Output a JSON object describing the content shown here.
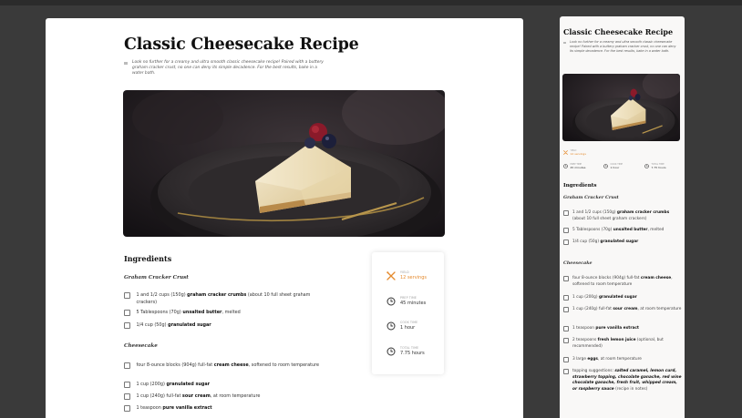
{
  "recipe": {
    "title": "Classic Cheesecake Recipe",
    "intro": "Look no further for a creamy and ultra smooth classic cheesecake recipe! Paired with a buttery graham cracker crust, no one can deny its simple decadence. For the best results, bake in a water bath.",
    "hero_alt": "slice of cheesecake with berries on a dark plate"
  },
  "ingredients": {
    "heading": "Ingredients",
    "groups": [
      {
        "name": "Graham Cracker Crust",
        "items": [
          {
            "pre": "1 and 1/2 cups (150g) ",
            "bold": "graham cracker crumbs",
            "post": " (about 10 full sheet graham crackers)"
          },
          {
            "pre": "5 Tablespoons (70g) ",
            "bold": "unsalted butter",
            "post": ", melted"
          },
          {
            "pre": "1/4 cup (50g) ",
            "bold": "granulated sugar",
            "post": ""
          }
        ]
      },
      {
        "name": "Cheesecake",
        "items": [
          {
            "pre": "four 8-ounce blocks (904g) full-fat ",
            "bold": "cream cheese",
            "post": ", softened to room temperature"
          },
          {
            "pre": "1 cup (200g) ",
            "bold": "granulated sugar",
            "post": ""
          },
          {
            "pre": "1 cup (240g) full-fat ",
            "bold": "sour cream",
            "post": ", at room temperature"
          },
          {
            "pre": "1 teaspoon ",
            "bold": "pure vanilla extract",
            "post": ""
          },
          {
            "pre": "2 teaspoons ",
            "bold": "fresh lemon juice",
            "post": " (optional, but recommended)"
          },
          {
            "pre": "3 large ",
            "bold": "eggs",
            "post": ", at room temperature"
          },
          {
            "pre": "topping suggestions: ",
            "italic": "salted caramel, lemon curd, strawberry topping, chocolate ganache, red wine chocolate ganache, fresh fruit, whipped cream, or raspberry sauce",
            "post": " (recipe in notes)"
          }
        ]
      }
    ]
  },
  "meta": {
    "yield": {
      "label": "Yield",
      "value": "12 servings"
    },
    "prep": {
      "label": "Prep Time",
      "value": "45 minutes"
    },
    "cook": {
      "label": "Cook Time",
      "value": "1 hour"
    },
    "total": {
      "label": "Total Time",
      "value": "7.75 hours"
    }
  },
  "colors": {
    "accent": "#e58a2d",
    "page_bg": "#3a3a3a"
  }
}
